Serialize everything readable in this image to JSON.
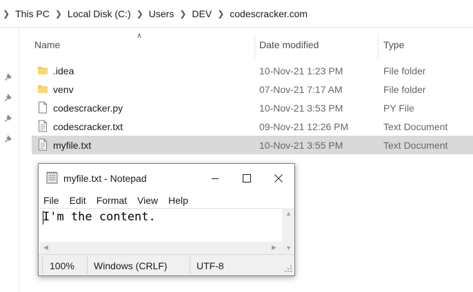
{
  "breadcrumb": {
    "items": [
      "This PC",
      "Local Disk (C:)",
      "Users",
      "DEV",
      "codescracker.com"
    ]
  },
  "columns": {
    "name": "Name",
    "date_modified": "Date modified",
    "type": "Type"
  },
  "files": [
    {
      "name": ".idea",
      "date": "10-Nov-21 1:23 PM",
      "type": "File folder",
      "icon": "folder-icon"
    },
    {
      "name": "venv",
      "date": "07-Nov-21 7:17 AM",
      "type": "File folder",
      "icon": "folder-icon"
    },
    {
      "name": "codescracker.py",
      "date": "10-Nov-21 3:53 PM",
      "type": "PY File",
      "icon": "file-icon"
    },
    {
      "name": "codescracker.txt",
      "date": "09-Nov-21 12:26 PM",
      "type": "Text Document",
      "icon": "text-file-icon"
    },
    {
      "name": "myfile.txt",
      "date": "10-Nov-21 3:55 PM",
      "type": "Text Document",
      "icon": "text-file-icon",
      "selected": true
    }
  ],
  "notepad": {
    "title": "myfile.txt - Notepad",
    "menu": [
      "File",
      "Edit",
      "Format",
      "View",
      "Help"
    ],
    "content": "I'm the content.",
    "status": {
      "zoom": "100%",
      "line_ending": "Windows (CRLF)",
      "encoding": "UTF-8"
    }
  },
  "colors": {
    "selection": "#d9d9d9",
    "folder": "#f5c542",
    "secondary_text": "#666666"
  }
}
